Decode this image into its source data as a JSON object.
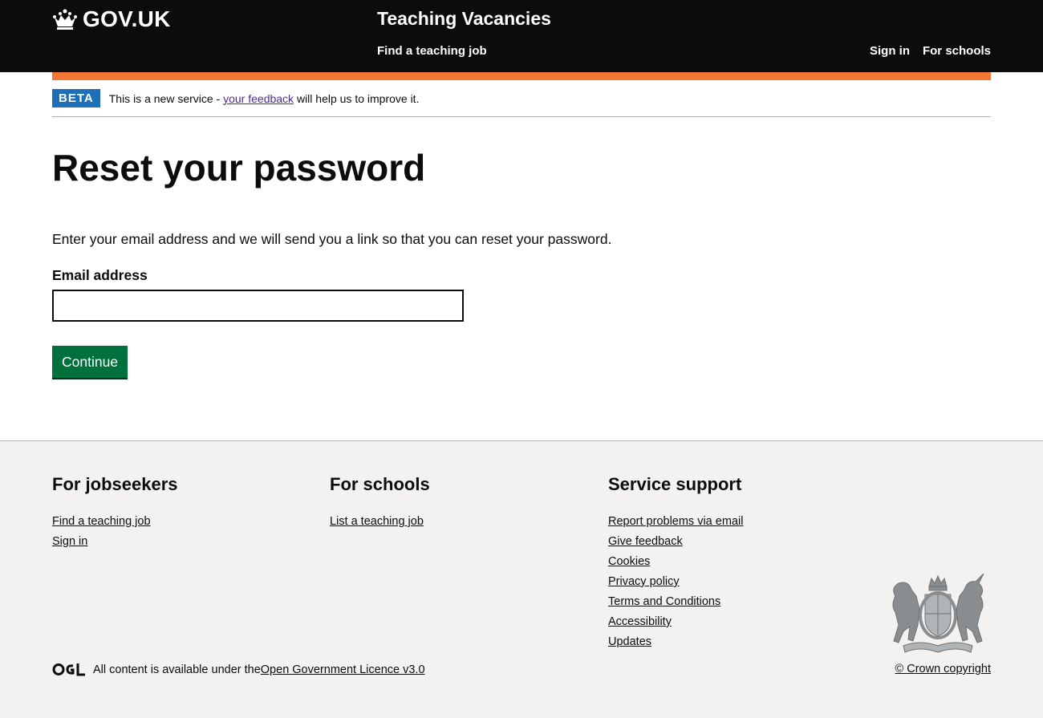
{
  "header": {
    "logo_text": "GOV.UK",
    "service_name": "Teaching Vacancies",
    "nav_find": "Find a teaching job",
    "nav_sign_in": "Sign in",
    "nav_for_schools": "For schools"
  },
  "phase_banner": {
    "tag": "BETA",
    "text_before": "This is a new service - ",
    "link": "your feedback",
    "text_after": " will help us to improve it."
  },
  "main": {
    "title": "Reset your password",
    "intro": "Enter your email address and we will send you a link so that you can reset your password.",
    "email_label": "Email address",
    "email_value": "",
    "continue_label": "Continue"
  },
  "footer": {
    "jobseekers": {
      "heading": "For jobseekers",
      "links": [
        "Find a teaching job",
        "Sign in"
      ]
    },
    "schools": {
      "heading": "For schools",
      "links": [
        "List a teaching job"
      ]
    },
    "support": {
      "heading": "Service support",
      "links": [
        "Report problems via email",
        "Give feedback",
        "Cookies",
        "Privacy policy",
        "Terms and Conditions",
        "Accessibility",
        "Updates"
      ]
    },
    "licence_text": "All content is available under the ",
    "licence_link": "Open Government Licence v3.0",
    "copyright": "© Crown copyright"
  },
  "colors": {
    "header_bg": "#0b0c0c",
    "accent_bar": "#f47738",
    "beta_tag": "#1d70b8",
    "button": "#00703c",
    "visited_link": "#4c2c92",
    "footer_bg": "#f3f2f1"
  },
  "icons": [
    "crown-icon",
    "ogl-logo",
    "royal-coat-of-arms"
  ]
}
